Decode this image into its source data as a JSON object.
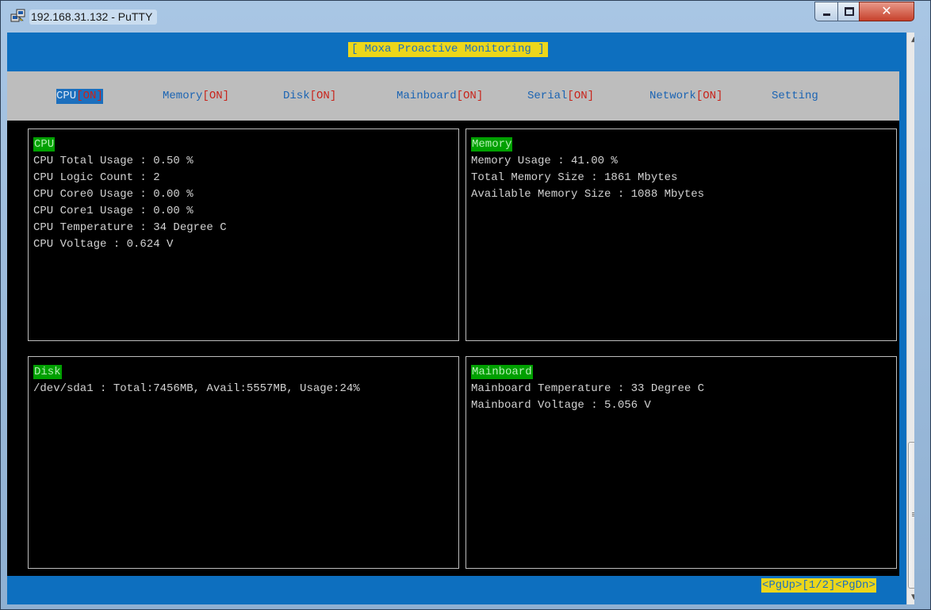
{
  "window": {
    "title": "192.168.31.132 - PuTTY",
    "icon": "putty-icon",
    "controls": {
      "minimize": "minimize-icon",
      "maximize": "maximize-icon",
      "close": "close-icon"
    }
  },
  "app": {
    "title": "[ Moxa Proactive Monitoring ]"
  },
  "menu": {
    "items": [
      {
        "label": "CPU",
        "status": "[ON]",
        "active": true
      },
      {
        "label": "Memory",
        "status": "[ON]"
      },
      {
        "label": "Disk",
        "status": "[ON]"
      },
      {
        "label": "Mainboard",
        "status": "[ON]"
      },
      {
        "label": "Serial",
        "status": "[ON]"
      },
      {
        "label": "Network",
        "status": "[ON]"
      },
      {
        "label": "Setting",
        "status": ""
      }
    ]
  },
  "panels": {
    "cpu": {
      "title": "CPU",
      "lines": [
        "CPU Total Usage : 0.50 %",
        "CPU Logic Count : 2",
        "CPU Core0 Usage : 0.00 %",
        "CPU Core1 Usage : 0.00 %",
        "CPU Temperature : 34 Degree C",
        "CPU Voltage : 0.624 V"
      ]
    },
    "memory": {
      "title": "Memory",
      "lines": [
        "Memory Usage : 41.00 %",
        "Total Memory Size : 1861 Mbytes",
        "Available Memory Size : 1088 Mbytes"
      ]
    },
    "disk": {
      "title": "Disk",
      "lines": [
        "/dev/sda1 : Total:7456MB, Avail:5557MB, Usage:24%"
      ]
    },
    "mainboard": {
      "title": "Mainboard",
      "lines": [
        "Mainboard Temperature : 33 Degree C",
        "Mainboard Voltage : 5.056 V"
      ]
    }
  },
  "pager": {
    "text": "<PgUp>[1/2]<PgDn>"
  },
  "colors": {
    "terminal_bg": "#0d6fbf",
    "highlight_yellow": "#ecd61a",
    "menu_bg": "#bdbdbd",
    "status_on": "#c8241b",
    "panel_title_green": "#00a000"
  }
}
